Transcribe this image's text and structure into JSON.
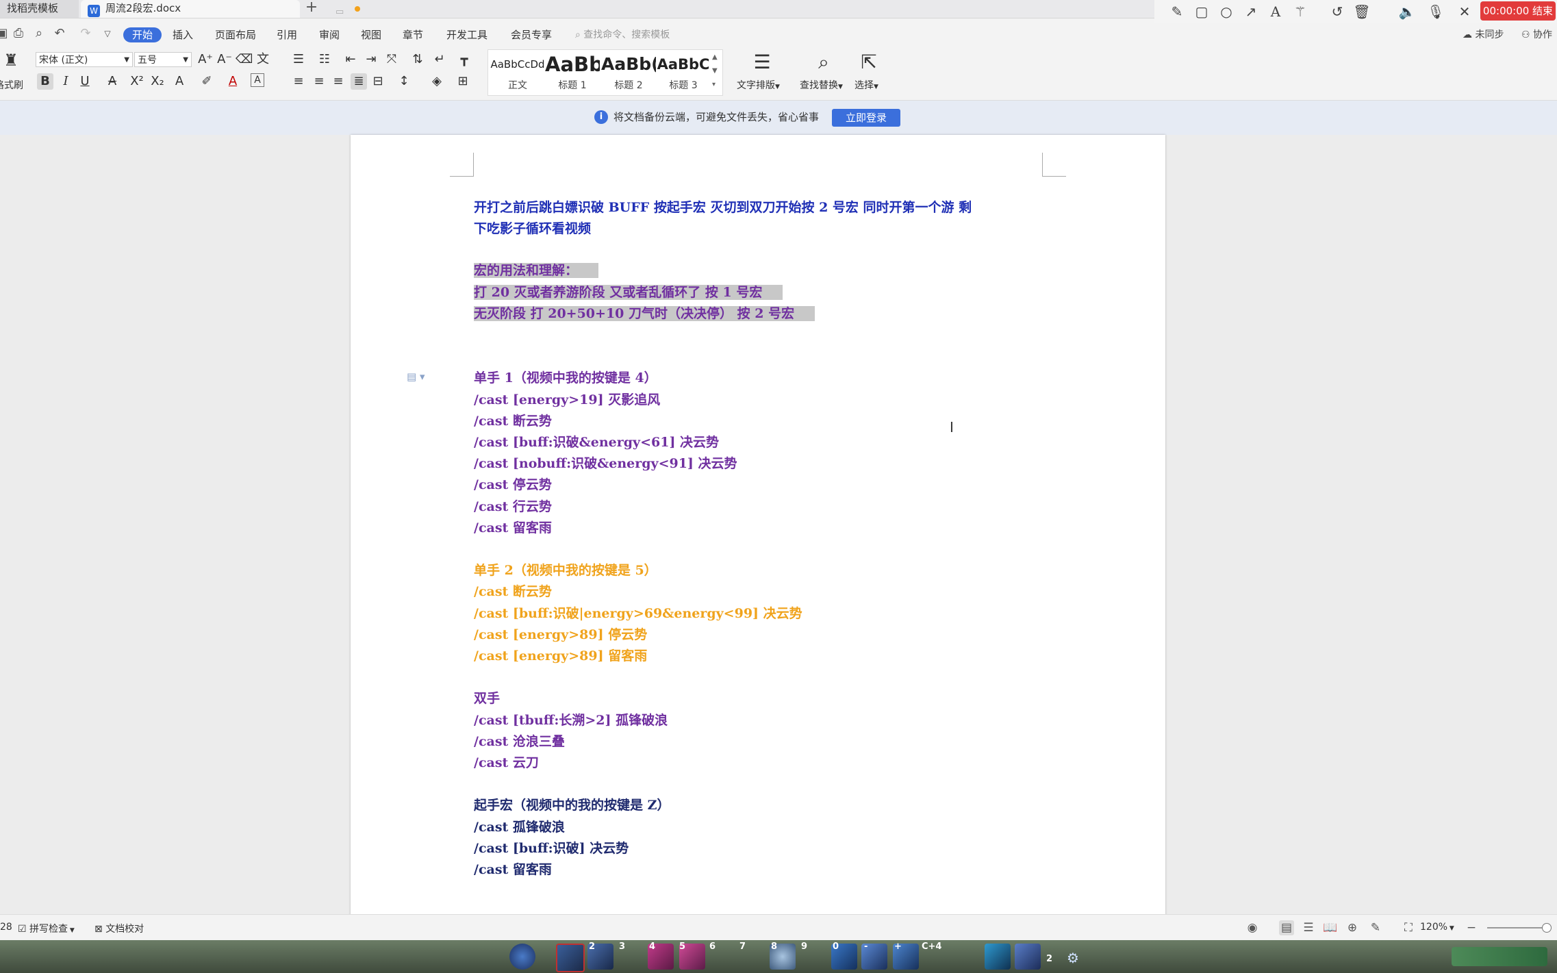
{
  "tabs": {
    "template_tab": "找稻壳模板",
    "doc_tab": "周流2段宏.docx",
    "doc_icon": "W",
    "new_tab": "+"
  },
  "recorder": {
    "timer_label": "00:00:00 结束",
    "icons": [
      "pencil-icon",
      "rectangle-icon",
      "circle-icon",
      "arrow-icon",
      "text-icon",
      "magic-wand-icon",
      "undo-icon",
      "delete-icon",
      "speaker-icon",
      "microphone-icon",
      "close-icon"
    ]
  },
  "menu": {
    "items": [
      "开始",
      "插入",
      "页面布局",
      "引用",
      "审阅",
      "视图",
      "章节",
      "开发工具",
      "会员专享"
    ],
    "search_placeholder": "查找命令、搜索模板",
    "sync": "未同步",
    "collab": "协作"
  },
  "ribbon": {
    "format_painter": "格式刷",
    "font_name": "宋体 (正文)",
    "font_size": "五号",
    "styles": [
      {
        "preview": "AaBbCcDd",
        "label": "正文"
      },
      {
        "preview": "AaBb",
        "label": "标题 1"
      },
      {
        "preview": "AaBb(",
        "label": "标题 2"
      },
      {
        "preview": "AaBbC",
        "label": "标题 3"
      }
    ],
    "text_layout": "文字排版",
    "find_replace": "查找替换",
    "select": "选择"
  },
  "infobar": {
    "message": "将文档备份云端，可避免文件丢失，省心省事",
    "login_button": "立即登录"
  },
  "document": {
    "intro_line1": "开打之前后跳白嫖识破 BUFF      按起手宏  灭切到双刀开始按 2 号宏  同时开第一个游      剩",
    "intro_line2": "下吃影子循环看视频",
    "usage_title": "宏的用法和理解：",
    "usage_line1": "打 20 灭或者养游阶段  又或者乱循环了  按 1 号宏",
    "usage_line2": "无灭阶段  打 20+50+10 刀气时（决决停）  按 2 号宏",
    "single1_title": "单手 1（视频中我的按键是 4）",
    "single1_lines": [
      "/cast [energy>19]  灭影追风",
      "/cast  断云势",
      "/cast [buff:识破&energy<61]  决云势",
      "/cast [nobuff:识破&energy<91]  决云势",
      "/cast  停云势",
      "/cast  行云势",
      "/cast  留客雨"
    ],
    "single2_title": "单手 2（视频中我的按键是 5）",
    "single2_lines": [
      "/cast  断云势",
      "/cast [buff:识破|energy>69&energy<99]  决云势",
      "/cast [energy>89]  停云势",
      "/cast [energy>89]  留客雨"
    ],
    "dual_title": "双手",
    "dual_lines": [
      "/cast [tbuff:长溯>2]  孤锋破浪",
      "/cast  沧浪三叠",
      "/cast  云刀"
    ],
    "opener_title": "起手宏（视频中的我的按键是 Z）",
    "opener_lines": [
      "/cast  孤锋破浪",
      "/cast [buff:识破]  决云势",
      "/cast  留客雨"
    ]
  },
  "status": {
    "page_count": "28",
    "spell_check": "拼写检查",
    "doc_proof": "文档校对",
    "zoom": "120%"
  },
  "game": {
    "slot_numbers": [
      "2",
      "3",
      "4",
      "5",
      "6",
      "7",
      "8",
      "9",
      "0",
      "-",
      "+",
      "C+4",
      "2"
    ]
  }
}
